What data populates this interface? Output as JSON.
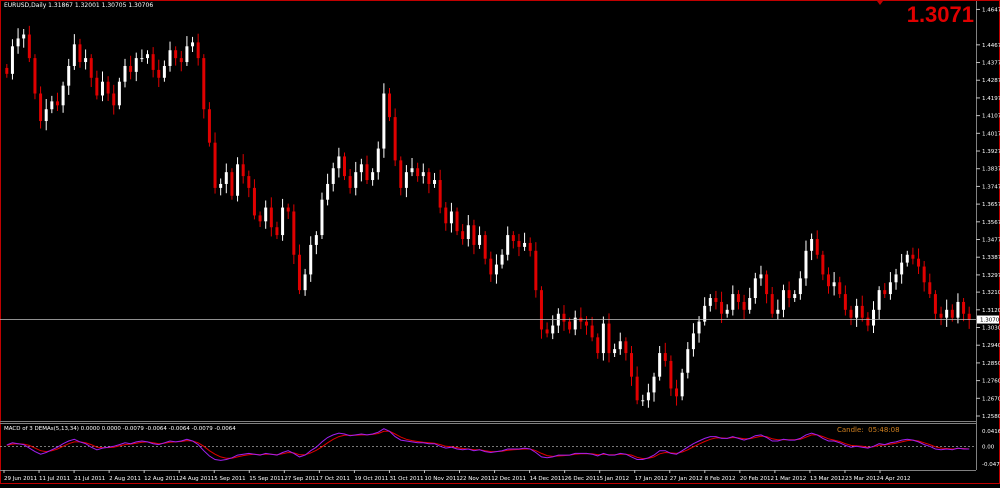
{
  "window": {
    "symbol_header": "EURUSD,Daily  1.31867 1.32001 1.30705 1.30706",
    "last_price_big": "1.3071",
    "current_price_tag": "1.30706"
  },
  "indicator": {
    "title": "MACD of 3 DEMAs(5,13,34) 0.0000 0.0000 -0.0079 -0.0064 -0.0064 -0.0079 -0.0064",
    "timer_label": "Candle:",
    "timer_value": "05:48:08",
    "axis_labels": [
      "0.0416",
      "0.00",
      "-0.047"
    ]
  },
  "colors": {
    "background": "#000000",
    "bull": "#ffffff",
    "bear": "#e00000",
    "grid_border": "#808080",
    "macd_line": "#a020f0",
    "signal_line": "#e00000",
    "timer": "#d08020",
    "price_line": "#c0c0c0"
  },
  "chart_data": {
    "type": "candlestick",
    "price_axis_labels": [
      "1.46475",
      "1.44675",
      "1.43775",
      "1.42875",
      "1.41975",
      "1.41075",
      "1.40175",
      "1.39275",
      "1.38375",
      "1.37475",
      "1.36575",
      "1.35675",
      "1.34775",
      "1.33875",
      "1.32975",
      "1.32100",
      "1.31200",
      "1.30300",
      "1.29400",
      "1.28500",
      "1.27600",
      "1.26700",
      "1.25800"
    ],
    "ylim": [
      1.258,
      1.4665
    ],
    "current_price": 1.30706,
    "date_labels": [
      "29 Jun 2011",
      "11 Jul 2011",
      "21 Jul 2011",
      "2 Aug 2011",
      "12 Aug 2011",
      "24 Aug 2011",
      "5 Sep 2011",
      "15 Sep 2011",
      "27 Sep 2011",
      "7 Oct 2011",
      "19 Oct 2011",
      "31 Oct 2011",
      "10 Nov 2011",
      "22 Nov 2011",
      "2 Dec 2011",
      "14 Dec 2011",
      "26 Dec 2011",
      "5 Jan 2012",
      "17 Jan 2012",
      "27 Jan 2012",
      "8 Feb 2012",
      "20 Feb 2012",
      "1 Mar 2012",
      "13 Mar 2012",
      "23 Mar 2012",
      "4 Apr 2012"
    ],
    "close_series": [
      1.432,
      1.446,
      1.45,
      1.452,
      1.44,
      1.422,
      1.408,
      1.414,
      1.418,
      1.416,
      1.426,
      1.436,
      1.447,
      1.438,
      1.44,
      1.43,
      1.421,
      1.428,
      1.422,
      1.416,
      1.428,
      1.436,
      1.433,
      1.44,
      1.44,
      1.442,
      1.434,
      1.43,
      1.436,
      1.444,
      1.44,
      1.438,
      1.446,
      1.448,
      1.44,
      1.414,
      1.397,
      1.374,
      1.376,
      1.382,
      1.37,
      1.386,
      1.38,
      1.374,
      1.36,
      1.357,
      1.364,
      1.354,
      1.35,
      1.364,
      1.362,
      1.34,
      1.322,
      1.33,
      1.345,
      1.35,
      1.368,
      1.376,
      1.384,
      1.39,
      1.38,
      1.374,
      1.382,
      1.386,
      1.378,
      1.382,
      1.394,
      1.422,
      1.41,
      1.388,
      1.374,
      1.382,
      1.384,
      1.38,
      1.382,
      1.376,
      1.378,
      1.364,
      1.356,
      1.362,
      1.352,
      1.348,
      1.355,
      1.345,
      1.35,
      1.338,
      1.33,
      1.335,
      1.34,
      1.35,
      1.347,
      1.344,
      1.346,
      1.342,
      1.322,
      1.302,
      1.3,
      1.304,
      1.31,
      1.306,
      1.302,
      1.308,
      1.306,
      1.304,
      1.298,
      1.29,
      1.305,
      1.29,
      1.292,
      1.296,
      1.29,
      1.278,
      1.266,
      1.266,
      1.27,
      1.278,
      1.29,
      1.286,
      1.272,
      1.268,
      1.28,
      1.292,
      1.3,
      1.306,
      1.314,
      1.318,
      1.316,
      1.31,
      1.312,
      1.32,
      1.316,
      1.312,
      1.318,
      1.328,
      1.33,
      1.32,
      1.31,
      1.312,
      1.322,
      1.318,
      1.32,
      1.328,
      1.342,
      1.348,
      1.34,
      1.33,
      1.324,
      1.326,
      1.32,
      1.312,
      1.308,
      1.314,
      1.308,
      1.304,
      1.312,
      1.322,
      1.32,
      1.326,
      1.33,
      1.336,
      1.34,
      1.338,
      1.334,
      1.326,
      1.32,
      1.31,
      1.308,
      1.312,
      1.308,
      1.316,
      1.31,
      1.307
    ],
    "macd_series": [
      0.003,
      0.008,
      0.006,
      0.004,
      -0.004,
      -0.012,
      -0.018,
      -0.014,
      -0.008,
      -0.002,
      0.006,
      0.012,
      0.016,
      0.01,
      0.006,
      -0.002,
      -0.008,
      -0.004,
      -0.002,
      0.0,
      0.004,
      0.008,
      0.006,
      0.01,
      0.012,
      0.01,
      0.006,
      0.004,
      0.008,
      0.012,
      0.01,
      0.012,
      0.016,
      0.012,
      0.004,
      -0.01,
      -0.022,
      -0.03,
      -0.032,
      -0.03,
      -0.026,
      -0.02,
      -0.018,
      -0.016,
      -0.018,
      -0.02,
      -0.016,
      -0.018,
      -0.02,
      -0.014,
      -0.01,
      -0.016,
      -0.024,
      -0.02,
      -0.01,
      -0.002,
      0.01,
      0.02,
      0.026,
      0.03,
      0.028,
      0.024,
      0.026,
      0.028,
      0.026,
      0.028,
      0.032,
      0.04,
      0.034,
      0.022,
      0.014,
      0.012,
      0.01,
      0.008,
      0.008,
      0.006,
      0.006,
      0.0,
      -0.004,
      -0.002,
      -0.006,
      -0.008,
      -0.006,
      -0.01,
      -0.008,
      -0.012,
      -0.014,
      -0.012,
      -0.01,
      -0.006,
      -0.006,
      -0.006,
      -0.004,
      -0.006,
      -0.014,
      -0.024,
      -0.026,
      -0.024,
      -0.02,
      -0.02,
      -0.02,
      -0.016,
      -0.016,
      -0.016,
      -0.018,
      -0.022,
      -0.016,
      -0.02,
      -0.02,
      -0.016,
      -0.018,
      -0.024,
      -0.03,
      -0.03,
      -0.026,
      -0.02,
      -0.01,
      -0.01,
      -0.016,
      -0.018,
      -0.01,
      -0.002,
      0.006,
      0.012,
      0.018,
      0.022,
      0.022,
      0.018,
      0.018,
      0.022,
      0.018,
      0.014,
      0.018,
      0.024,
      0.026,
      0.02,
      0.012,
      0.012,
      0.016,
      0.014,
      0.014,
      0.018,
      0.026,
      0.03,
      0.026,
      0.018,
      0.012,
      0.012,
      0.008,
      0.002,
      -0.002,
      0.0,
      -0.002,
      -0.004,
      0.0,
      0.006,
      0.004,
      0.008,
      0.01,
      0.014,
      0.016,
      0.014,
      0.01,
      0.004,
      0.0,
      -0.006,
      -0.008,
      -0.006,
      -0.008,
      -0.004,
      -0.006,
      -0.006
    ],
    "signal_series": [
      0.002,
      0.005,
      0.006,
      0.005,
      0.002,
      -0.004,
      -0.01,
      -0.012,
      -0.01,
      -0.006,
      0.0,
      0.006,
      0.01,
      0.01,
      0.008,
      0.004,
      -0.002,
      -0.003,
      -0.003,
      -0.002,
      0.001,
      0.004,
      0.005,
      0.007,
      0.009,
      0.01,
      0.008,
      0.006,
      0.007,
      0.009,
      0.01,
      0.011,
      0.013,
      0.012,
      0.008,
      0.0,
      -0.01,
      -0.018,
      -0.024,
      -0.027,
      -0.027,
      -0.024,
      -0.021,
      -0.019,
      -0.018,
      -0.019,
      -0.018,
      -0.018,
      -0.019,
      -0.017,
      -0.014,
      -0.015,
      -0.019,
      -0.019,
      -0.015,
      -0.009,
      -0.001,
      0.008,
      0.016,
      0.022,
      0.025,
      0.025,
      0.025,
      0.026,
      0.026,
      0.027,
      0.029,
      0.034,
      0.034,
      0.028,
      0.021,
      0.016,
      0.013,
      0.011,
      0.009,
      0.008,
      0.007,
      0.004,
      0.0,
      -0.001,
      -0.003,
      -0.005,
      -0.006,
      -0.008,
      -0.008,
      -0.01,
      -0.012,
      -0.012,
      -0.011,
      -0.009,
      -0.008,
      -0.007,
      -0.006,
      -0.006,
      -0.01,
      -0.016,
      -0.021,
      -0.023,
      -0.022,
      -0.021,
      -0.02,
      -0.018,
      -0.017,
      -0.017,
      -0.017,
      -0.019,
      -0.018,
      -0.019,
      -0.019,
      -0.018,
      -0.018,
      -0.02,
      -0.025,
      -0.028,
      -0.027,
      -0.024,
      -0.017,
      -0.014,
      -0.015,
      -0.016,
      -0.013,
      -0.008,
      -0.001,
      0.005,
      0.011,
      0.016,
      0.019,
      0.019,
      0.018,
      0.02,
      0.019,
      0.017,
      0.017,
      0.02,
      0.023,
      0.022,
      0.017,
      0.015,
      0.015,
      0.015,
      0.015,
      0.016,
      0.021,
      0.026,
      0.026,
      0.022,
      0.017,
      0.014,
      0.011,
      0.006,
      0.002,
      0.001,
      0.0,
      -0.002,
      -0.001,
      0.002,
      0.003,
      0.005,
      0.007,
      0.01,
      0.013,
      0.014,
      0.012,
      0.008,
      0.004,
      -0.001,
      -0.004,
      -0.005,
      -0.006,
      -0.005,
      -0.005,
      -0.006
    ],
    "macd_ylim": [
      -0.047,
      0.0416
    ],
    "grid": false
  }
}
